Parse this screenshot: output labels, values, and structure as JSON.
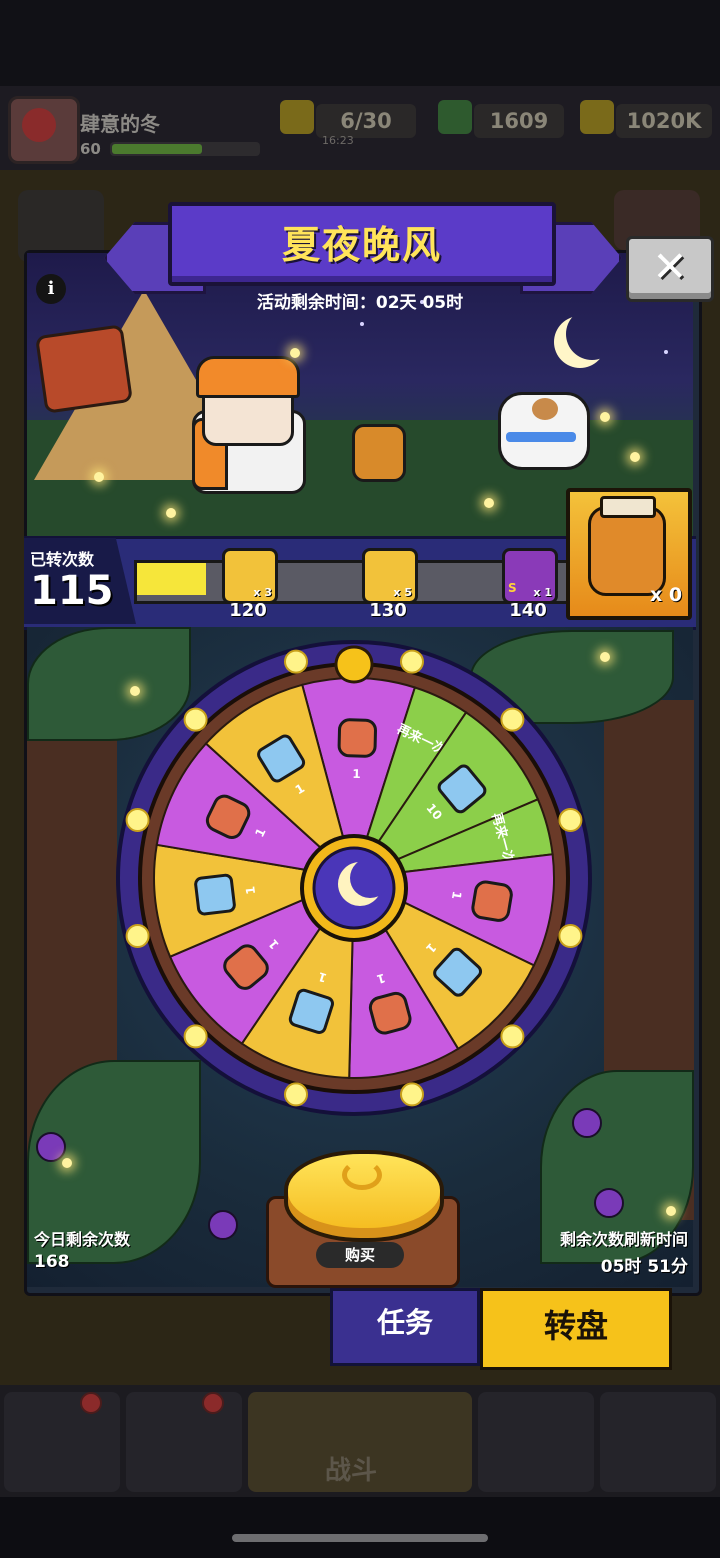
{
  "player": {
    "name": "肆意的冬",
    "level": "60"
  },
  "resources": {
    "energy": "6/30",
    "energy_timer": "16:23",
    "gems": "1609",
    "coins": "1020K"
  },
  "event": {
    "title": "夏夜晚风",
    "timer": "活动剩余时间：02天 05时",
    "info_icon": "i",
    "close_icon": "✕"
  },
  "progress": {
    "label": "已转次数",
    "count": "115",
    "fill": 0.16,
    "milestones": [
      {
        "value": "120",
        "multiplier": "x 3",
        "color": "#f2c23a"
      },
      {
        "value": "130",
        "multiplier": "x 5",
        "color": "#f2c23a"
      },
      {
        "value": "140",
        "multiplier": "x 1",
        "badge": "S",
        "color": "#8a3ab8"
      }
    ],
    "reward_jar_count": "x 0"
  },
  "wheel": {
    "segments": [
      {
        "type": "fragment",
        "amount": "1",
        "color": "#c85ae0"
      },
      {
        "type": "retry",
        "text": "再来一次",
        "color": "#8ccf4a"
      },
      {
        "type": "key",
        "amount": "10",
        "color": "#8ccf4a"
      },
      {
        "type": "retry",
        "text": "再来一次",
        "color": "#8ccf4a"
      },
      {
        "type": "fragment",
        "amount": "1",
        "color": "#c85ae0"
      },
      {
        "type": "key",
        "amount": "1",
        "color": "#f2c23a"
      },
      {
        "type": "fragment",
        "amount": "1",
        "color": "#c85ae0"
      },
      {
        "type": "key",
        "amount": "1",
        "color": "#f2c23a"
      },
      {
        "type": "fragment",
        "amount": "1",
        "color": "#c85ae0"
      },
      {
        "type": "key",
        "amount": "1",
        "color": "#f2c23a"
      },
      {
        "type": "fragment",
        "amount": "1",
        "color": "#c85ae0"
      },
      {
        "type": "key",
        "amount": "1",
        "color": "#f2c23a"
      }
    ]
  },
  "today": {
    "label": "今日剩余次数",
    "value": "168"
  },
  "refresh": {
    "label": "剩余次数刷新时间",
    "value": "05时 51分"
  },
  "spin": {
    "buy_label": "购买"
  },
  "tabs": {
    "tasks": "任务",
    "wheel": "转盘"
  },
  "nav": {
    "battle": "战斗"
  },
  "colors": {
    "accent": "#5b3bc8",
    "title": "#ffe45a",
    "tab_active": "#f6c21a"
  }
}
